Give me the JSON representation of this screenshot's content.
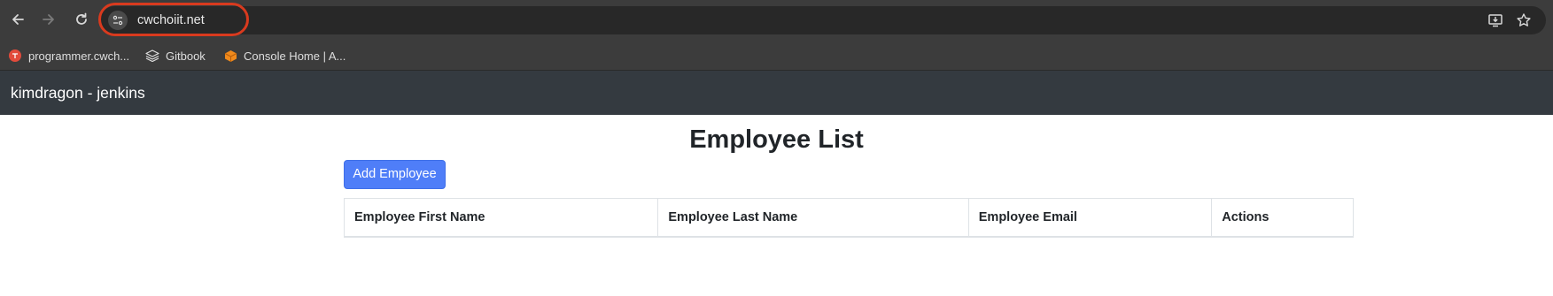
{
  "browser": {
    "url": "cwchoiit.net",
    "bookmarks": [
      {
        "label": "programmer.cwch...",
        "icon": "red-circle-icon",
        "color": "#e24b3b"
      },
      {
        "label": "Gitbook",
        "icon": "gitbook-stack-icon"
      },
      {
        "label": "Console Home | A...",
        "icon": "aws-cube-icon",
        "color": "#f08a1c"
      }
    ]
  },
  "app": {
    "brand": "kimdragon - jenkins",
    "title": "Employee List",
    "add_button": "Add Employee",
    "table": {
      "columns": [
        "Employee First Name",
        "Employee Last Name",
        "Employee Email",
        "Actions"
      ],
      "rows": []
    }
  },
  "colors": {
    "accent": "#4f7ef8",
    "navbar": "#343a40",
    "highlight_ring": "#d93a1e"
  }
}
